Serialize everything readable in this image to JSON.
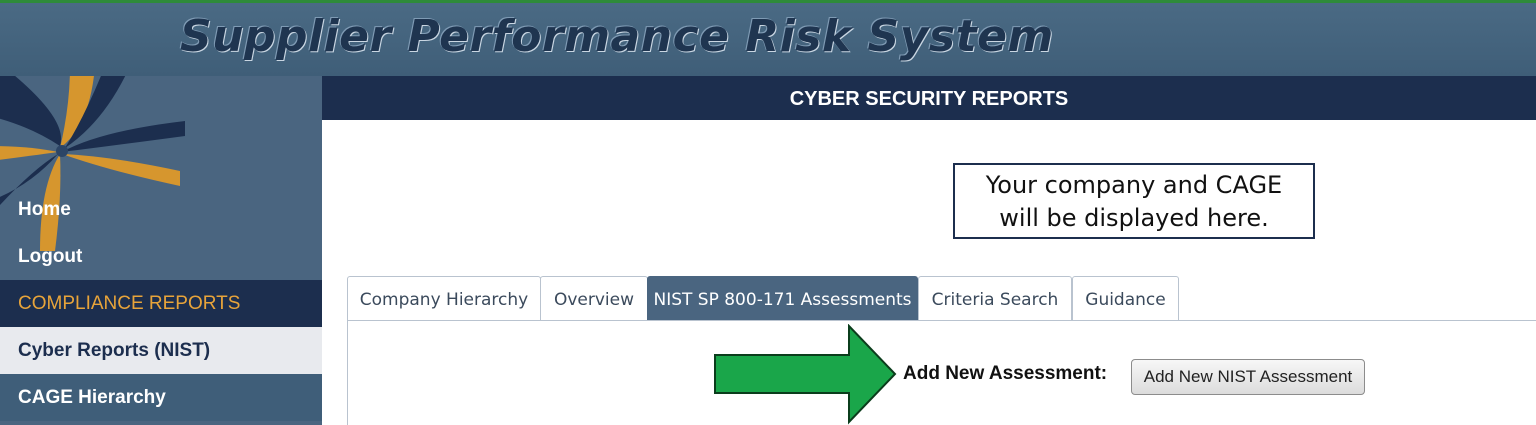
{
  "header": {
    "title": "Supplier Performance Risk System"
  },
  "sidebar": {
    "items": [
      {
        "label": "Home"
      },
      {
        "label": "Logout"
      },
      {
        "label": "COMPLIANCE REPORTS"
      },
      {
        "label": "Cyber Reports (NIST)"
      },
      {
        "label": "CAGE Hierarchy"
      }
    ]
  },
  "main": {
    "section_title": "CYBER SECURITY REPORTS",
    "callout": {
      "line1": "Your company and CAGE",
      "line2": "will be displayed here."
    },
    "tabs": [
      {
        "label": "Company Hierarchy"
      },
      {
        "label": "Overview"
      },
      {
        "label": "NIST SP 800-171 Assessments"
      },
      {
        "label": "Criteria Search"
      },
      {
        "label": "Guidance"
      }
    ],
    "active_tab": "NIST SP 800-171 Assessments",
    "add_label": "Add New Assessment:",
    "add_button": "Add New NIST Assessment"
  },
  "icons": {
    "logo": "star-logo-icon",
    "arrow": "right-arrow-icon"
  },
  "colors": {
    "header_bg": "#4a6a84",
    "navy": "#1c2e4e",
    "section_accent": "#e8a43a",
    "arrow_green": "#1aa64a",
    "top_line": "#2e8b3a"
  }
}
